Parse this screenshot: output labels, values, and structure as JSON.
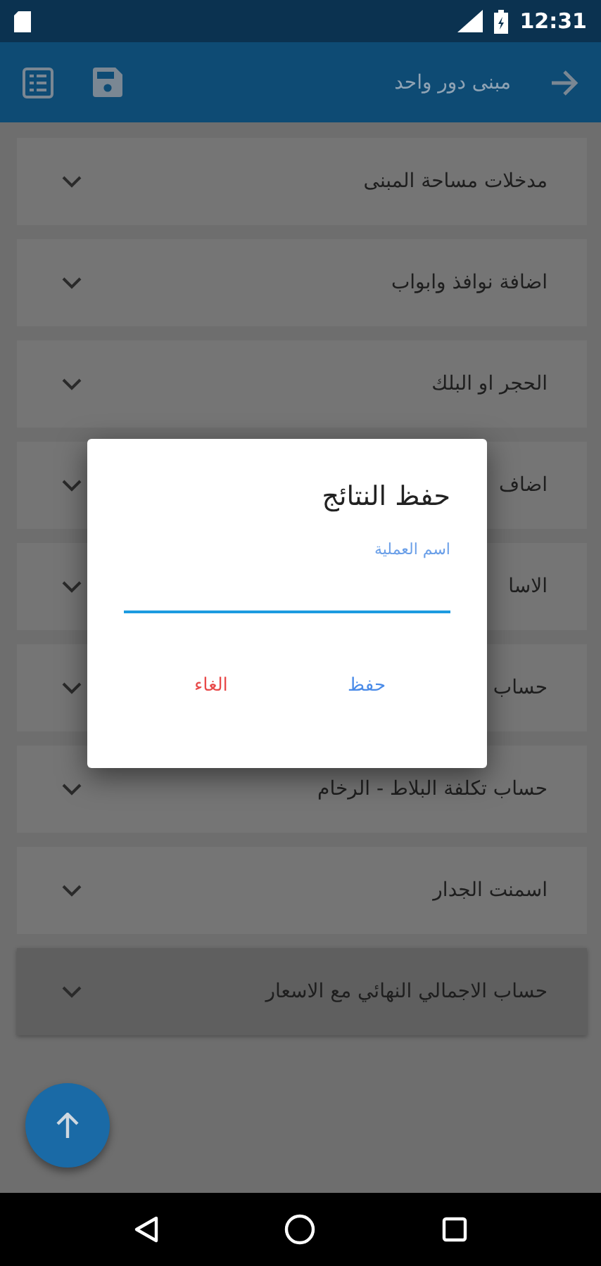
{
  "status_bar": {
    "time": "12:31"
  },
  "app_bar": {
    "title": "مبنى دور واحد"
  },
  "sections": [
    {
      "title": "مدخلات مساحة المبنى",
      "highlighted": false
    },
    {
      "title": "اضافة نوافذ وابواب",
      "highlighted": false
    },
    {
      "title": "الحجر او البلك",
      "highlighted": false
    },
    {
      "title": "اضاف",
      "highlighted": false
    },
    {
      "title": "الاسا",
      "highlighted": false
    },
    {
      "title": "حساب",
      "highlighted": false
    },
    {
      "title": "حساب تكلفة البلاط - الرخام",
      "highlighted": false
    },
    {
      "title": "اسمنت الجدار",
      "highlighted": false
    },
    {
      "title": "حساب الاجمالي النهائي مع الاسعار",
      "highlighted": true
    }
  ],
  "dialog": {
    "title": "حفظ النتائج",
    "field": {
      "label": "اسم العملية",
      "focused": true
    },
    "buttons": [
      {
        "label": "حفظ",
        "kind": "confirm"
      },
      {
        "label": "الغاء",
        "kind": "cancel"
      }
    ]
  }
}
